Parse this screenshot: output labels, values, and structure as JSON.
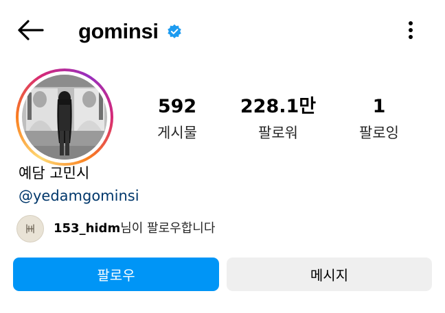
{
  "colors": {
    "accent": "#0095f6",
    "verified": "#1d9bf0",
    "link": "#00376b",
    "secondary_button": "#efefef"
  },
  "header": {
    "back_icon": "arrow-left-icon",
    "username": "gominsi",
    "verified_icon": "verified-badge-icon",
    "more_icon": "more-vertical-icon"
  },
  "stats": {
    "posts": {
      "value": "592",
      "label": "게시물"
    },
    "followers": {
      "value": "228.1만",
      "label": "팔로워"
    },
    "following": {
      "value": "1",
      "label": "팔로잉"
    }
  },
  "bio": {
    "display_name": "예담 고민시",
    "handle": "@yedamgominsi"
  },
  "followed_by": {
    "username": "153_hidm",
    "suffix": "님이 팔로우합니다"
  },
  "actions": {
    "follow_label": "팔로우",
    "message_label": "메시지"
  }
}
